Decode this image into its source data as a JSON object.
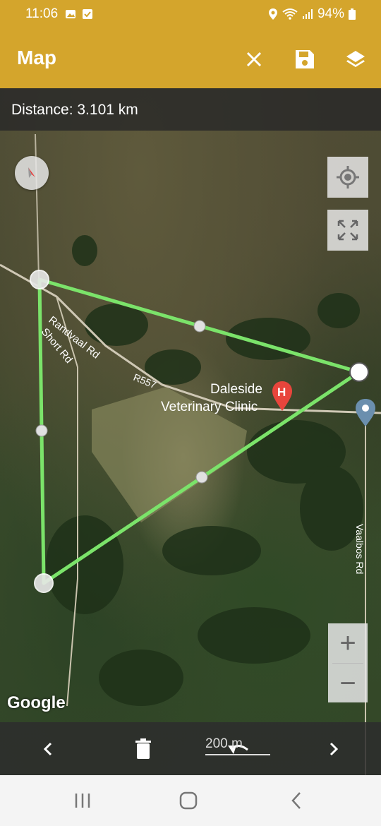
{
  "status_bar": {
    "time": "11:06",
    "battery": "94%"
  },
  "app_bar": {
    "title": "Map",
    "icons": [
      "close-icon",
      "save-icon",
      "layers-icon"
    ]
  },
  "distance": {
    "text": "Distance: 3.101 km"
  },
  "map": {
    "roads": {
      "randvaal": "Randvaal Rd",
      "short": "Short Rd",
      "r557": "R557",
      "vaalbos": "Vaalbos Rd"
    },
    "poi": {
      "line1": "Daleside",
      "line2": "Veterinary Clinic",
      "marker_letter": "H"
    },
    "route_color": "#7BE36A",
    "google_logo": "Google"
  },
  "zoom": {
    "in": "+",
    "out": "−"
  },
  "scale_label": "200 m",
  "toolbar": {
    "icons": [
      "chevron-left-icon",
      "trash-icon",
      "undo-icon",
      "chevron-right-icon"
    ]
  },
  "nav_bar": {
    "icons": [
      "recents-icon",
      "home-icon",
      "back-icon"
    ]
  },
  "colors": {
    "header": "#D4A52C"
  }
}
